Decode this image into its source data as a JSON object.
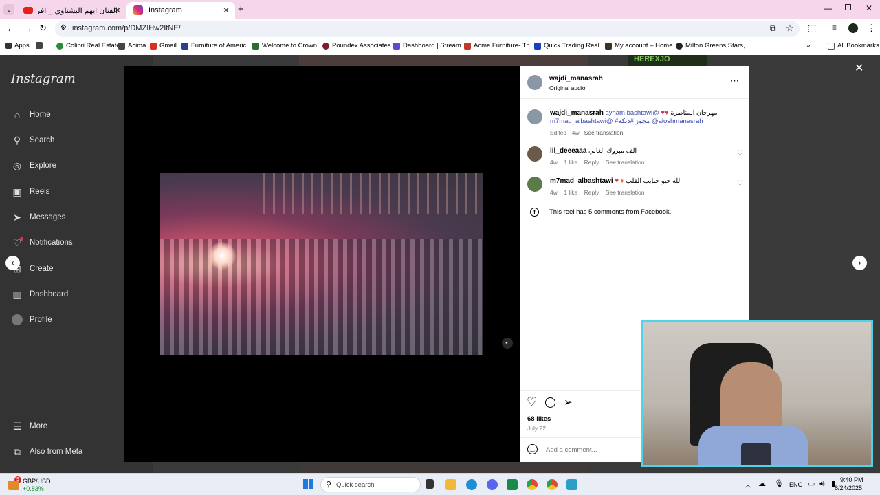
{
  "browser": {
    "tabs": [
      {
        "title": "الفنان ايهم البشتاوي _ افراح آل ال..."
      },
      {
        "title": "Instagram"
      }
    ],
    "url": "instagram.com/p/DMZIHw2ItNE/",
    "bookmarks": [
      "Apps",
      "Colibri Real Estate",
      "Acima",
      "Gmail",
      "Furniture of Americ...",
      "Welcome to Crown...",
      "Poundex Associates...",
      "Dashboard | Stream...",
      "Acme Furniture- Th...",
      "Quick Trading Real...",
      "My account – Home...",
      "Milton Greens Stars,..."
    ],
    "all_bookmarks": "All Bookmarks"
  },
  "sidebar": {
    "logo": "Instagram",
    "items": [
      {
        "label": "Home",
        "icon": "home-icon"
      },
      {
        "label": "Search",
        "icon": "search-icon"
      },
      {
        "label": "Explore",
        "icon": "compass-icon"
      },
      {
        "label": "Reels",
        "icon": "reels-icon"
      },
      {
        "label": "Messages",
        "icon": "messages-icon"
      },
      {
        "label": "Notifications",
        "icon": "heart-icon"
      },
      {
        "label": "Create",
        "icon": "plus-icon"
      },
      {
        "label": "Dashboard",
        "icon": "dashboard-icon"
      },
      {
        "label": "Profile",
        "icon": "avatar"
      }
    ],
    "more": "More",
    "also_from_meta": "Also from Meta"
  },
  "background_banner": "HEREXJO",
  "post": {
    "username": "wajdi_manasrah",
    "audio": "Original audio",
    "caption_user": "wajdi_manasrah",
    "caption_line1_mention": "ayham.bashtawi@",
    "caption_line1_text": "مهرجان المناصرة",
    "caption_line2": "m7mad_albashtawi@ #مجوز #دبكة @aloshmanasrah",
    "caption_meta": "Edited · 4w",
    "see_translation": "See translation",
    "comments": [
      {
        "user": "lil_deeeaaa",
        "text": "الف مبروك الغالي",
        "age": "4w",
        "likes": "1 like",
        "reply": "Reply",
        "translate": "See translation"
      },
      {
        "user": "m7mad_albashtawi",
        "text": "الله حبو حبايب القلب",
        "age": "4w",
        "likes": "1 like",
        "reply": "Reply",
        "translate": "See translation"
      }
    ],
    "facebook_note": "This reel has 5 comments from Facebook.",
    "likes": "68 likes",
    "date": "July 22",
    "comment_placeholder": "Add a comment..."
  },
  "taskbar": {
    "ticker_symbol": "GBP/USD",
    "ticker_change": "0.83%+",
    "ticker_badge": "9",
    "search_placeholder": "Quick search",
    "lang": "ENG",
    "time": "9:40 PM",
    "date": "8/24/2025"
  },
  "colors": {
    "tabstrip": "#f6d6ea",
    "page_dim": "#3a3a3a",
    "link": "#3a46a8",
    "webcam_border": "#4fd3e6"
  }
}
